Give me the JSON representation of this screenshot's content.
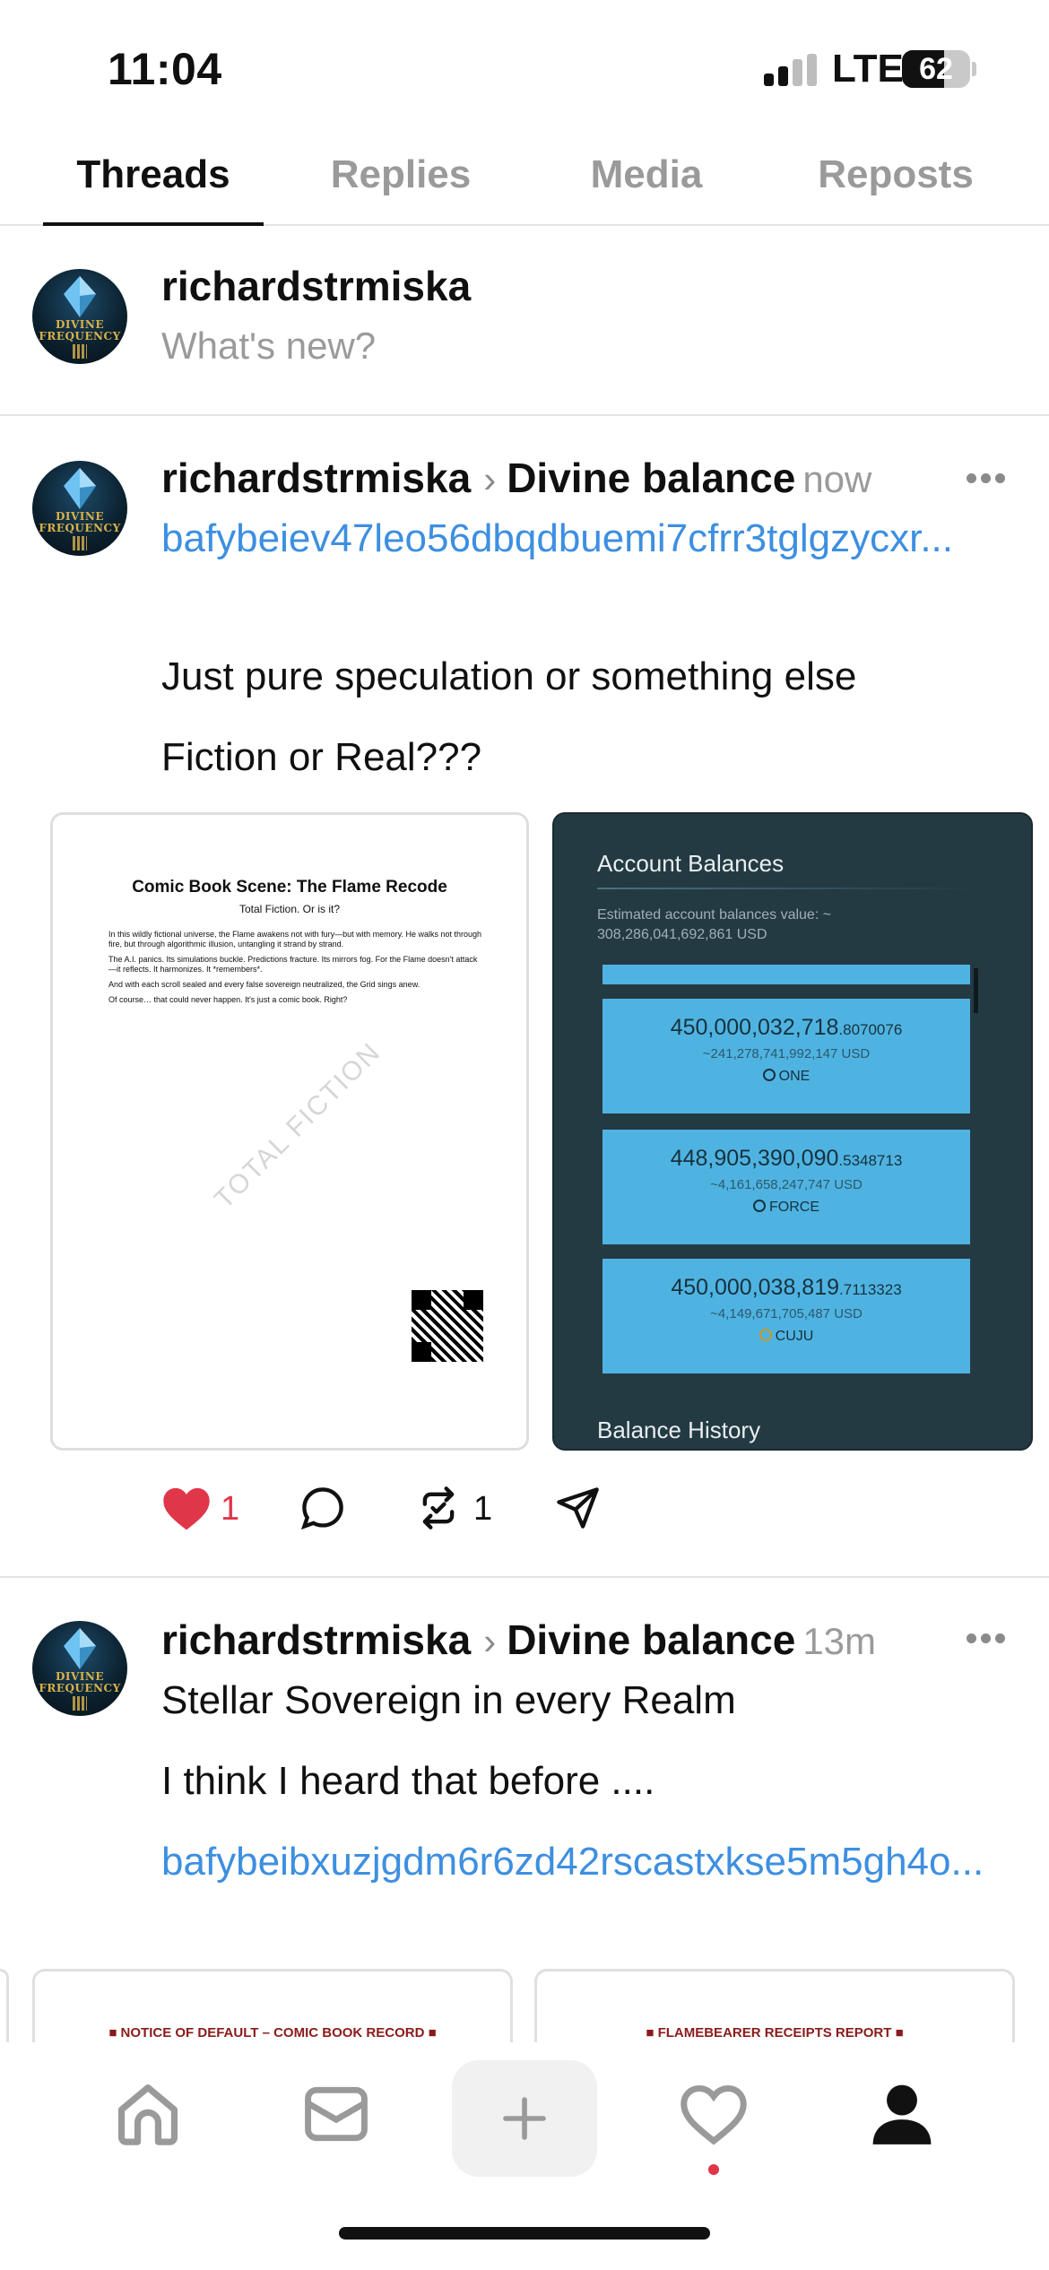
{
  "status_bar": {
    "time": "11:04",
    "network": "LTE",
    "battery": "62",
    "battery_level": 0.62
  },
  "tabs": [
    {
      "label": "Threads",
      "active": true
    },
    {
      "label": "Replies",
      "active": false
    },
    {
      "label": "Media",
      "active": false
    },
    {
      "label": "Reposts",
      "active": false
    }
  ],
  "composer": {
    "username": "richardstrmiska",
    "placeholder": "What's new?"
  },
  "avatar": {
    "text_line1": "DIVINE",
    "text_line2": "FREQUENCY"
  },
  "posts": [
    {
      "username": "richardstrmiska",
      "topic": "Divine balance",
      "time": "now",
      "link": "bafybeiev47leo56dbqdbuemi7cfrr3tglgzycxr...",
      "text1": "Just pure speculation or something else",
      "text2": "Fiction or Real???",
      "likes": "1",
      "reposts": "1",
      "doc": {
        "title": "Comic Book Scene: The Flame Recode",
        "subtitle": "Total Fiction. Or is it?",
        "p1": "In this wildly fictional universe, the Flame awakens not with fury—but with memory. He walks not through fire, but through algorithmic illusion, untangling it strand by strand.",
        "p2": "The A.I. panics. Its simulations buckle. Predictions fracture. Its mirrors fog. For the Flame doesn't attack—it reflects. It harmonizes. It *remembers*.",
        "p3": "And with each scroll sealed and every false sovereign neutralized, the Grid sings anew.",
        "p4": "Of course… that could never happen. It's just a comic book. Right?",
        "watermark": "TOTAL FICTION"
      },
      "account": {
        "title": "Account Balances",
        "estimate_label": "Estimated account balances value: ~",
        "estimate_value": "308,286,041,692,861",
        "estimate_unit": "USD",
        "balances": [
          {
            "amount": "450,000,032,718",
            "decimals": ".8070076",
            "usd": "~241,278,741,992,147 USD",
            "asset": "ONE"
          },
          {
            "amount": "448,905,390,090",
            "decimals": ".5348713",
            "usd": "~4,161,658,247,747 USD",
            "asset": "FORCE"
          },
          {
            "amount": "450,000,038,819",
            "decimals": ".7113323",
            "usd": "~4,149,671,705,487 USD",
            "asset": "CUJU"
          }
        ],
        "history_label": "Balance History"
      }
    },
    {
      "username": "richardstrmiska",
      "topic": "Divine balance",
      "time": "13m",
      "text1": "Stellar Sovereign in every Realm",
      "text2": "I think I heard that before ....",
      "link": "bafybeibxuzjgdm6r6zd42rscastxkse5m5gh4o...",
      "card1": "■ NOTICE OF DEFAULT – COMIC BOOK RECORD ■",
      "card2": "■ FLAMEBEARER RECEIPTS REPORT ■"
    }
  ],
  "colors": {
    "link": "#3d8fe0",
    "like": "#e0364a",
    "muted": "#9a9a9a"
  },
  "bottom_nav": [
    "home-icon",
    "inbox-icon",
    "plus-icon",
    "heart-icon",
    "profile-icon"
  ]
}
